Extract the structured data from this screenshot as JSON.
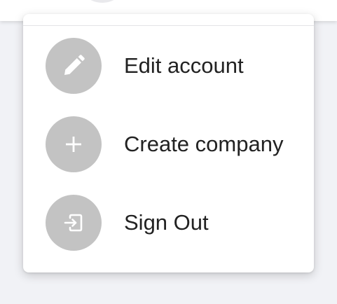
{
  "menu": {
    "items": [
      {
        "label": "Edit account",
        "icon": "pencil-icon"
      },
      {
        "label": "Create company",
        "icon": "plus-icon"
      },
      {
        "label": "Sign Out",
        "icon": "sign-out-icon"
      }
    ]
  },
  "colors": {
    "icon_circle": "#c3c3c3",
    "icon_glyph": "#ffffff",
    "label_text": "#222222",
    "page_background": "#f1f2f6"
  }
}
